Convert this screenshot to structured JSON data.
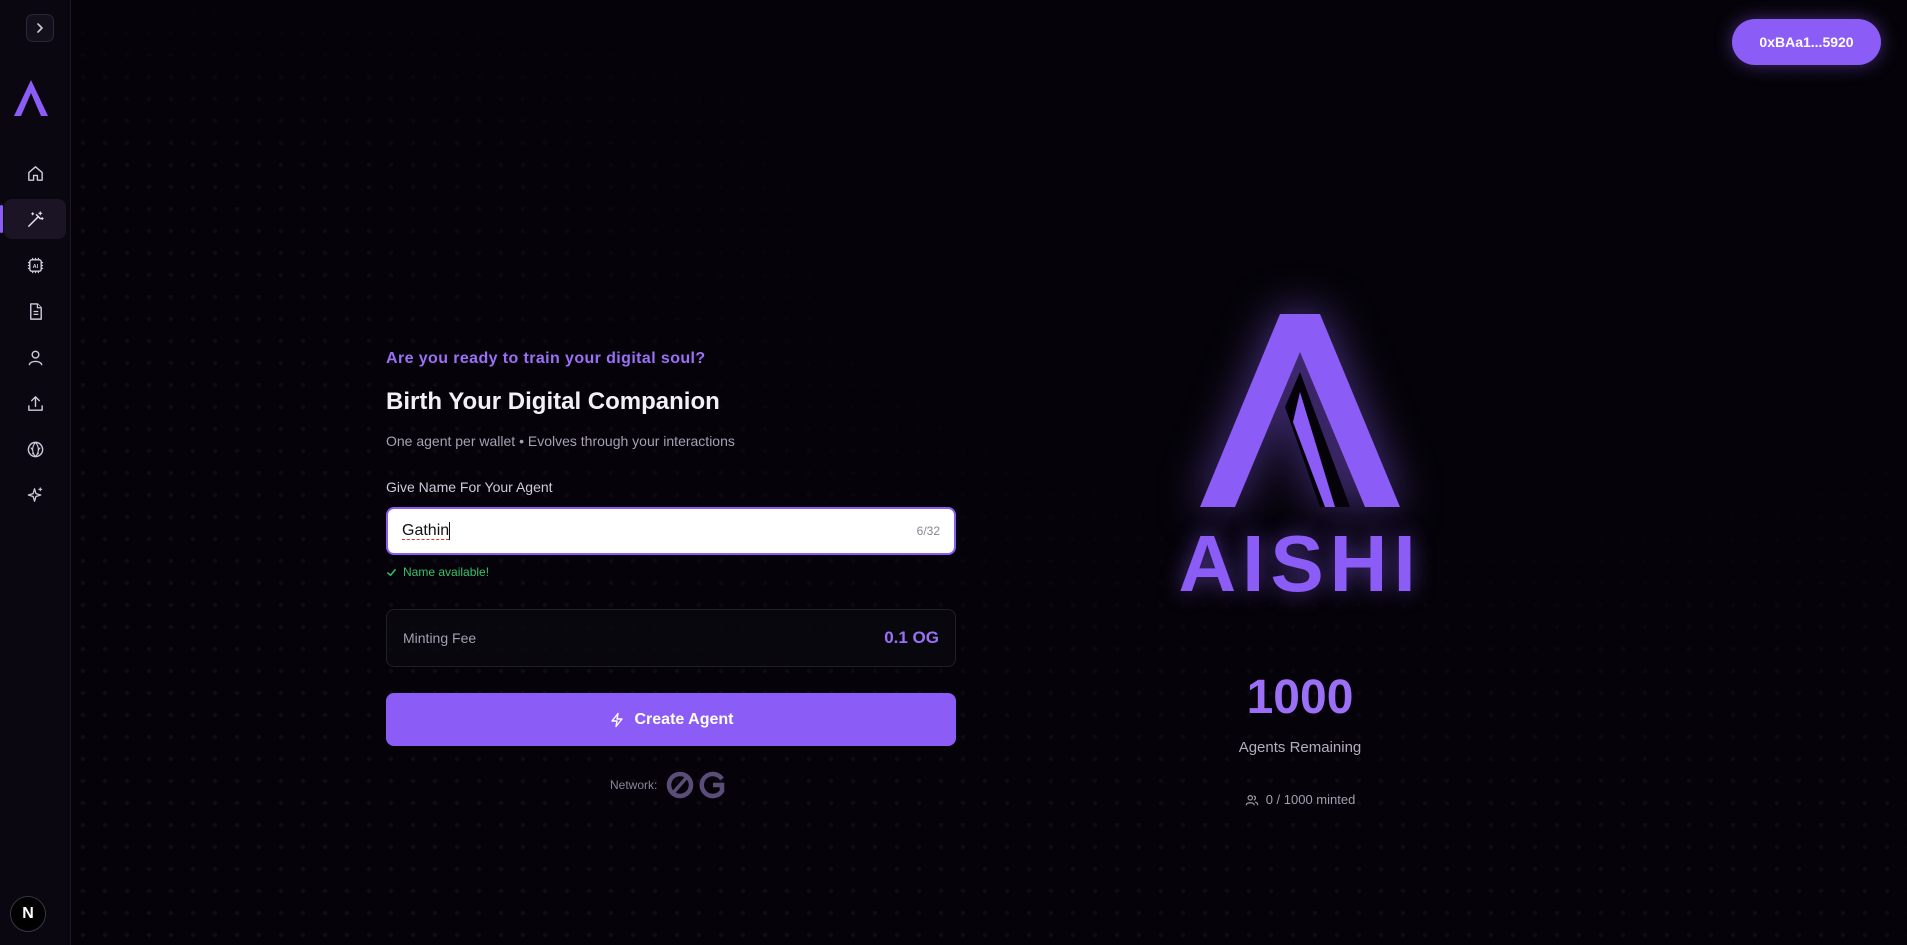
{
  "sidebar": {
    "collapse_icon": "chevron-right-icon",
    "logo_letter": "A",
    "nav": [
      {
        "icon": "home-icon",
        "active": false
      },
      {
        "icon": "magic-wand-icon",
        "active": true
      },
      {
        "icon": "ai-chip-icon",
        "active": false
      },
      {
        "icon": "document-icon",
        "active": false
      },
      {
        "icon": "user-icon",
        "active": false
      },
      {
        "icon": "upload-icon",
        "active": false
      },
      {
        "icon": "globe-icon",
        "active": false
      },
      {
        "icon": "sparkles-icon",
        "active": false
      }
    ],
    "avatar_letter": "N"
  },
  "header": {
    "wallet_label": "0xBAa1...5920"
  },
  "form": {
    "eyebrow": "Are you ready to train your digital soul?",
    "title": "Birth Your Digital Companion",
    "subtitle": "One agent per wallet • Evolves through your interactions",
    "name_label": "Give Name For Your Agent",
    "name_value": "Gathin",
    "name_counter": "6/32",
    "availability": "Name available!",
    "fee_label": "Minting Fee",
    "fee_value": "0.1 OG",
    "create_label": "Create Agent",
    "network_label": "Network:"
  },
  "brand": {
    "wordmark": "AISHI",
    "remaining_count": "1000",
    "remaining_label": "Agents Remaining",
    "minted": "0 / 1000 minted"
  },
  "colors": {
    "accent": "#8b5cf6",
    "success": "#34c26a",
    "background": "#050309"
  }
}
